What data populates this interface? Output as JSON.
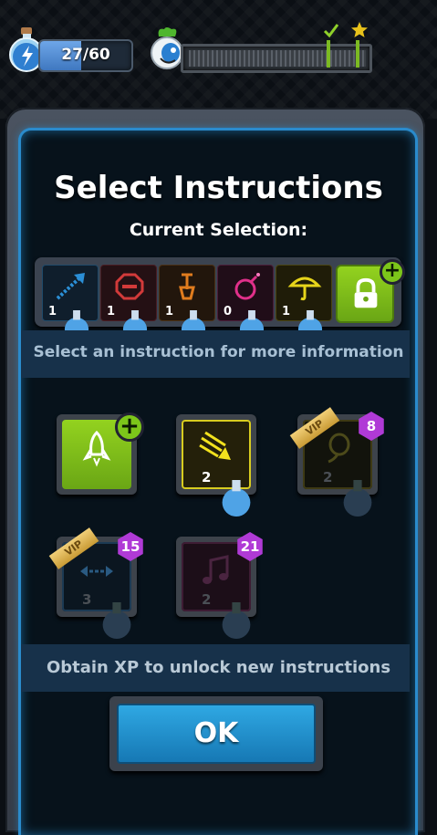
{
  "hud": {
    "energy_text": "27/60",
    "energy_current": 27,
    "energy_max": 60,
    "xp_progress_fraction": 0.0,
    "milestone_icons": [
      "check-icon",
      "star-icon"
    ]
  },
  "dialog": {
    "title": "Select Instructions",
    "current_selection_label": "Current Selection:",
    "hint": "Select an instruction for more information",
    "footer": "Obtain XP to unlock new instructions",
    "ok_label": "OK"
  },
  "selection_slots": [
    {
      "icon": "jump-arrow-icon",
      "count": "1",
      "color": "#2b8fd6"
    },
    {
      "icon": "stop-sign-icon",
      "count": "1",
      "color": "#d23a3a"
    },
    {
      "icon": "shovel-icon",
      "count": "1",
      "color": "#e07c1e"
    },
    {
      "icon": "bomb-icon",
      "count": "0",
      "color": "#e0308a"
    },
    {
      "icon": "umbrella-icon",
      "count": "1",
      "color": "#e6d41a"
    },
    {
      "icon": "lock-icon",
      "count": "",
      "color": "#7cc61a"
    }
  ],
  "instructions": [
    {
      "icon": "rocket-icon",
      "count": "",
      "locked": false,
      "badge": "+"
    },
    {
      "icon": "dash-arrow-icon",
      "count": "2",
      "locked": false,
      "badge": ""
    },
    {
      "icon": "balloon-icon",
      "count": "2",
      "locked": true,
      "vip": "VIP",
      "level": "8"
    },
    {
      "icon": "teleport-arrows-icon",
      "count": "3",
      "locked": true,
      "vip": "VIP",
      "level": "15"
    },
    {
      "icon": "music-note-icon",
      "count": "2",
      "locked": true,
      "level": "21"
    }
  ],
  "colors": {
    "accent_blue": "#2a8bcc",
    "unlock_green": "#7cc61a",
    "level_purple": "#b03ad6",
    "vip_gold": "#e2b95a"
  }
}
